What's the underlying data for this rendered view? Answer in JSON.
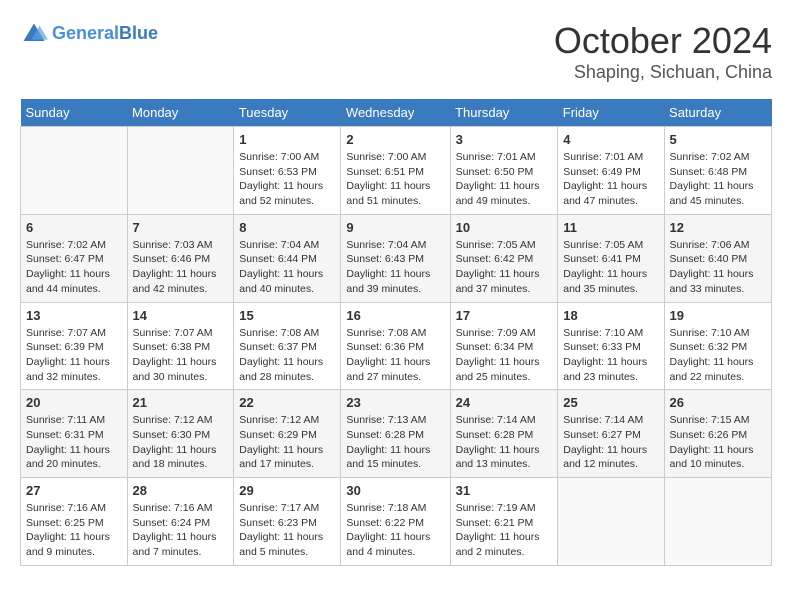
{
  "header": {
    "logo_general": "General",
    "logo_blue": "Blue",
    "title": "October 2024",
    "subtitle": "Shaping, Sichuan, China"
  },
  "days_of_week": [
    "Sunday",
    "Monday",
    "Tuesday",
    "Wednesday",
    "Thursday",
    "Friday",
    "Saturday"
  ],
  "weeks": [
    [
      {
        "day": "",
        "info": ""
      },
      {
        "day": "",
        "info": ""
      },
      {
        "day": "1",
        "sunrise": "Sunrise: 7:00 AM",
        "sunset": "Sunset: 6:53 PM",
        "daylight": "Daylight: 11 hours and 52 minutes."
      },
      {
        "day": "2",
        "sunrise": "Sunrise: 7:00 AM",
        "sunset": "Sunset: 6:51 PM",
        "daylight": "Daylight: 11 hours and 51 minutes."
      },
      {
        "day": "3",
        "sunrise": "Sunrise: 7:01 AM",
        "sunset": "Sunset: 6:50 PM",
        "daylight": "Daylight: 11 hours and 49 minutes."
      },
      {
        "day": "4",
        "sunrise": "Sunrise: 7:01 AM",
        "sunset": "Sunset: 6:49 PM",
        "daylight": "Daylight: 11 hours and 47 minutes."
      },
      {
        "day": "5",
        "sunrise": "Sunrise: 7:02 AM",
        "sunset": "Sunset: 6:48 PM",
        "daylight": "Daylight: 11 hours and 45 minutes."
      }
    ],
    [
      {
        "day": "6",
        "sunrise": "Sunrise: 7:02 AM",
        "sunset": "Sunset: 6:47 PM",
        "daylight": "Daylight: 11 hours and 44 minutes."
      },
      {
        "day": "7",
        "sunrise": "Sunrise: 7:03 AM",
        "sunset": "Sunset: 6:46 PM",
        "daylight": "Daylight: 11 hours and 42 minutes."
      },
      {
        "day": "8",
        "sunrise": "Sunrise: 7:04 AM",
        "sunset": "Sunset: 6:44 PM",
        "daylight": "Daylight: 11 hours and 40 minutes."
      },
      {
        "day": "9",
        "sunrise": "Sunrise: 7:04 AM",
        "sunset": "Sunset: 6:43 PM",
        "daylight": "Daylight: 11 hours and 39 minutes."
      },
      {
        "day": "10",
        "sunrise": "Sunrise: 7:05 AM",
        "sunset": "Sunset: 6:42 PM",
        "daylight": "Daylight: 11 hours and 37 minutes."
      },
      {
        "day": "11",
        "sunrise": "Sunrise: 7:05 AM",
        "sunset": "Sunset: 6:41 PM",
        "daylight": "Daylight: 11 hours and 35 minutes."
      },
      {
        "day": "12",
        "sunrise": "Sunrise: 7:06 AM",
        "sunset": "Sunset: 6:40 PM",
        "daylight": "Daylight: 11 hours and 33 minutes."
      }
    ],
    [
      {
        "day": "13",
        "sunrise": "Sunrise: 7:07 AM",
        "sunset": "Sunset: 6:39 PM",
        "daylight": "Daylight: 11 hours and 32 minutes."
      },
      {
        "day": "14",
        "sunrise": "Sunrise: 7:07 AM",
        "sunset": "Sunset: 6:38 PM",
        "daylight": "Daylight: 11 hours and 30 minutes."
      },
      {
        "day": "15",
        "sunrise": "Sunrise: 7:08 AM",
        "sunset": "Sunset: 6:37 PM",
        "daylight": "Daylight: 11 hours and 28 minutes."
      },
      {
        "day": "16",
        "sunrise": "Sunrise: 7:08 AM",
        "sunset": "Sunset: 6:36 PM",
        "daylight": "Daylight: 11 hours and 27 minutes."
      },
      {
        "day": "17",
        "sunrise": "Sunrise: 7:09 AM",
        "sunset": "Sunset: 6:34 PM",
        "daylight": "Daylight: 11 hours and 25 minutes."
      },
      {
        "day": "18",
        "sunrise": "Sunrise: 7:10 AM",
        "sunset": "Sunset: 6:33 PM",
        "daylight": "Daylight: 11 hours and 23 minutes."
      },
      {
        "day": "19",
        "sunrise": "Sunrise: 7:10 AM",
        "sunset": "Sunset: 6:32 PM",
        "daylight": "Daylight: 11 hours and 22 minutes."
      }
    ],
    [
      {
        "day": "20",
        "sunrise": "Sunrise: 7:11 AM",
        "sunset": "Sunset: 6:31 PM",
        "daylight": "Daylight: 11 hours and 20 minutes."
      },
      {
        "day": "21",
        "sunrise": "Sunrise: 7:12 AM",
        "sunset": "Sunset: 6:30 PM",
        "daylight": "Daylight: 11 hours and 18 minutes."
      },
      {
        "day": "22",
        "sunrise": "Sunrise: 7:12 AM",
        "sunset": "Sunset: 6:29 PM",
        "daylight": "Daylight: 11 hours and 17 minutes."
      },
      {
        "day": "23",
        "sunrise": "Sunrise: 7:13 AM",
        "sunset": "Sunset: 6:28 PM",
        "daylight": "Daylight: 11 hours and 15 minutes."
      },
      {
        "day": "24",
        "sunrise": "Sunrise: 7:14 AM",
        "sunset": "Sunset: 6:28 PM",
        "daylight": "Daylight: 11 hours and 13 minutes."
      },
      {
        "day": "25",
        "sunrise": "Sunrise: 7:14 AM",
        "sunset": "Sunset: 6:27 PM",
        "daylight": "Daylight: 11 hours and 12 minutes."
      },
      {
        "day": "26",
        "sunrise": "Sunrise: 7:15 AM",
        "sunset": "Sunset: 6:26 PM",
        "daylight": "Daylight: 11 hours and 10 minutes."
      }
    ],
    [
      {
        "day": "27",
        "sunrise": "Sunrise: 7:16 AM",
        "sunset": "Sunset: 6:25 PM",
        "daylight": "Daylight: 11 hours and 9 minutes."
      },
      {
        "day": "28",
        "sunrise": "Sunrise: 7:16 AM",
        "sunset": "Sunset: 6:24 PM",
        "daylight": "Daylight: 11 hours and 7 minutes."
      },
      {
        "day": "29",
        "sunrise": "Sunrise: 7:17 AM",
        "sunset": "Sunset: 6:23 PM",
        "daylight": "Daylight: 11 hours and 5 minutes."
      },
      {
        "day": "30",
        "sunrise": "Sunrise: 7:18 AM",
        "sunset": "Sunset: 6:22 PM",
        "daylight": "Daylight: 11 hours and 4 minutes."
      },
      {
        "day": "31",
        "sunrise": "Sunrise: 7:19 AM",
        "sunset": "Sunset: 6:21 PM",
        "daylight": "Daylight: 11 hours and 2 minutes."
      },
      {
        "day": "",
        "info": ""
      },
      {
        "day": "",
        "info": ""
      }
    ]
  ]
}
